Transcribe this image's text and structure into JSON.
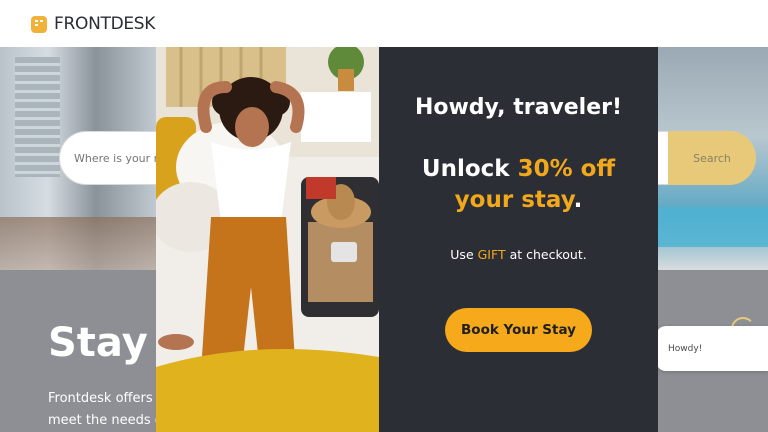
{
  "brand": {
    "name": "FRONTDESK",
    "accent": "#f5a91b"
  },
  "search": {
    "placeholder": "Where is your ne",
    "button_label": "Search"
  },
  "section": {
    "title": "Stay w",
    "text_line1": "Frontdesk offers o",
    "text_line2": "meet the needs o"
  },
  "chat": {
    "label": "Howdy!"
  },
  "modal": {
    "heading": "Howdy, traveler!",
    "offer_part1": "Unlock ",
    "offer_highlight": "30% off",
    "offer_line2_highlight": "your stay",
    "offer_line2_end": ".",
    "code_prefix": "Use ",
    "code": "GIFT",
    "code_suffix": " at checkout.",
    "cta_label": "Book Your Stay"
  }
}
